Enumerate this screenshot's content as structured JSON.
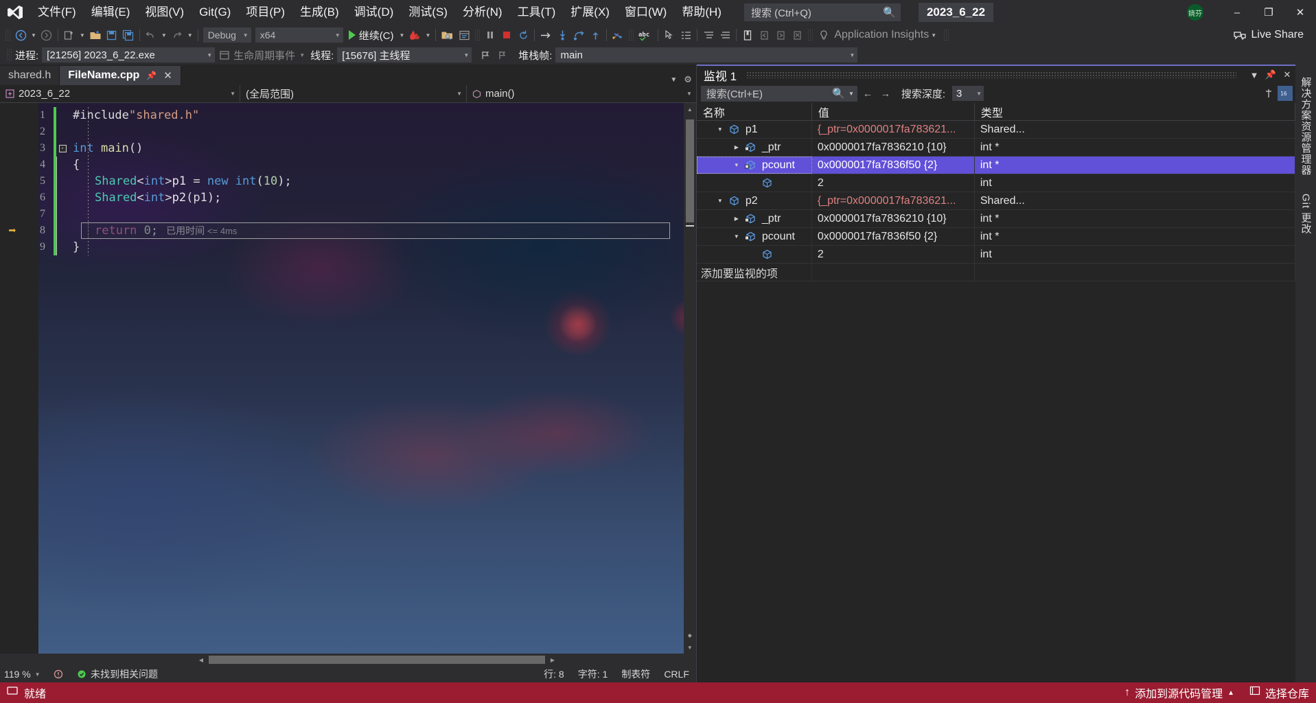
{
  "titlebar": {
    "logo_icon": "visual-studio-logo-icon",
    "menus": [
      {
        "label": "文件(F)"
      },
      {
        "label": "编辑(E)"
      },
      {
        "label": "视图(V)"
      },
      {
        "label": "Git(G)"
      },
      {
        "label": "项目(P)"
      },
      {
        "label": "生成(B)"
      },
      {
        "label": "调试(D)"
      },
      {
        "label": "测试(S)"
      },
      {
        "label": "分析(N)"
      },
      {
        "label": "工具(T)"
      },
      {
        "label": "扩展(X)"
      },
      {
        "label": "窗口(W)"
      },
      {
        "label": "帮助(H)"
      }
    ],
    "quick_search_placeholder": "搜索 (Ctrl+Q)",
    "search_icon": "magnifier-icon",
    "solution_name": "2023_6_22",
    "account_initials": "娆芬",
    "minimize_icon": "minimize-icon",
    "restore_icon": "restore-icon",
    "close_icon": "close-icon"
  },
  "toolbar": {
    "nav_back_icon": "navigate-back-icon",
    "nav_forward_icon": "navigate-forward-icon",
    "new_project_icon": "new-project-icon",
    "open_file_icon": "open-file-icon",
    "save_icon": "save-icon",
    "save_all_icon": "save-all-icon",
    "undo_icon": "undo-icon",
    "redo_icon": "redo-icon",
    "config": "Debug",
    "platform": "x64",
    "continue_label": "继续(C)",
    "continue_icon": "play-icon",
    "hot_reload_icon": "hot-reload-icon",
    "attach_icon": "attach-to-process-icon",
    "live_visual_tree_icon": "live-visual-tree-icon",
    "break_all_icon": "pause-icon",
    "stop_icon": "stop-debugging-icon",
    "restart_icon": "restart-icon",
    "show_next_icon": "show-next-statement-icon",
    "step_into_icon": "step-into-icon",
    "step_over_icon": "step-over-icon",
    "step_out_icon": "step-out-icon",
    "thread_icon": "threads-icon",
    "spell_icon": "spell-check-icon",
    "pointer_icon": "select-element-icon",
    "indent_icon": "indent-icon",
    "comment_icon": "comment-icon",
    "uncomment_icon": "uncomment-icon",
    "bookmark_icon": "bookmark-icon",
    "prev_bookmark_icon": "previous-bookmark-icon",
    "next_bookmark_icon": "next-bookmark-icon",
    "clear_bookmark_icon": "clear-bookmarks-icon",
    "insights_icon": "lightbulb-icon",
    "app_insights": "Application Insights",
    "live_share": "Live Share",
    "live_share_icon": "live-share-icon"
  },
  "debugbar": {
    "process_label": "进程:",
    "process_value": "[21256] 2023_6_22.exe",
    "lifecycle_label": "生命周期事件",
    "lifecycle_icon": "lifecycle-events-icon",
    "thread_label": "线程:",
    "thread_value": "[15676] 主线程",
    "flag_icon": "thread-flag-icon",
    "stackframe_label": "堆栈帧:",
    "stackframe_value": "main"
  },
  "editor": {
    "tabs": [
      {
        "label": "shared.h",
        "active": false
      },
      {
        "label": "FileName.cpp",
        "active": true
      }
    ],
    "tab_pin_icon": "pin-icon",
    "tab_close_icon": "close-icon",
    "nav": {
      "project": "2023_6_22",
      "project_icon": "cpp-project-icon",
      "scope": "(全局范围)",
      "member": "main()",
      "member_icon": "method-icon"
    },
    "lines": [
      {
        "n": "1",
        "tokens": [
          {
            "t": "#include",
            "c": "pp"
          },
          {
            "t": "\"shared.h\"",
            "c": "str"
          }
        ]
      },
      {
        "n": "2",
        "tokens": []
      },
      {
        "n": "3",
        "fold": "-",
        "tokens": [
          {
            "t": "int ",
            "c": "kw"
          },
          {
            "t": "main",
            "c": "fn"
          },
          {
            "t": "()",
            "c": "punc"
          }
        ]
      },
      {
        "n": "4",
        "tokens": [
          {
            "t": "{",
            "c": "punc"
          }
        ]
      },
      {
        "n": "5",
        "indent": 1,
        "tokens": [
          {
            "t": "Shared",
            "c": "type"
          },
          {
            "t": "<",
            "c": "punc"
          },
          {
            "t": "int",
            "c": "kw"
          },
          {
            "t": ">",
            "c": "punc"
          },
          {
            "t": "p1 ",
            "c": "ident"
          },
          {
            "t": "= ",
            "c": "punc"
          },
          {
            "t": "new ",
            "c": "kw"
          },
          {
            "t": "int",
            "c": "kw"
          },
          {
            "t": "(",
            "c": "punc"
          },
          {
            "t": "10",
            "c": "num"
          },
          {
            "t": ");",
            "c": "punc"
          }
        ]
      },
      {
        "n": "6",
        "indent": 1,
        "tokens": [
          {
            "t": "Shared",
            "c": "type"
          },
          {
            "t": "<",
            "c": "punc"
          },
          {
            "t": "int",
            "c": "kw"
          },
          {
            "t": ">",
            "c": "punc"
          },
          {
            "t": "p2",
            "c": "ident"
          },
          {
            "t": "(p1);",
            "c": "punc"
          }
        ]
      },
      {
        "n": "7",
        "indent": 1,
        "tokens": []
      },
      {
        "n": "8",
        "indent": 1,
        "current": true,
        "tokens": [
          {
            "t": "return ",
            "c": "kw2"
          },
          {
            "t": "0",
            "c": "num"
          },
          {
            "t": ";",
            "c": "punc"
          }
        ]
      },
      {
        "n": "9",
        "tokens": [
          {
            "t": "}",
            "c": "punc"
          }
        ]
      }
    ],
    "elapsed_label": "已用时间",
    "elapsed_value": "<= 4ms",
    "exec_arrow_icon": "current-statement-arrow-icon",
    "status": {
      "zoom": "119 %",
      "error_nav_icon": "error-navigation-icon",
      "issues_icon": "check-circle-icon",
      "issues": "未找到相关问题",
      "line_label": "行: 8",
      "char_label": "字符: 1",
      "tabs_label": "制表符",
      "eol_label": "CRLF"
    }
  },
  "watch": {
    "title": "监视 1",
    "float_icon": "window-dropdown-icon",
    "pin_icon": "pin-icon",
    "close_icon": "close-icon",
    "search_placeholder": "搜索(Ctrl+E)",
    "search_icon": "magnifier-icon",
    "search_dropdown_icon": "chevron-down-icon",
    "prev_icon": "arrow-left-icon",
    "next_icon": "arrow-right-icon",
    "depth_label": "搜索深度:",
    "depth_value": "3",
    "pin_col_icon": "pin-column-icon",
    "hex_icon": "hexadecimal-display-icon",
    "columns": [
      "名称",
      "值",
      "类型"
    ],
    "rows": [
      {
        "indent": 1,
        "expander": "expanded",
        "icon": "variable-icon",
        "name": "p1",
        "value": "{_ptr=0x0000017fa783621...",
        "value_style": "struct",
        "type": "Shared...",
        "selected": false
      },
      {
        "indent": 2,
        "expander": "collapsed",
        "icon": "private-field-icon",
        "name": "_ptr",
        "value": "0x0000017fa7836210 {10}",
        "value_style": "plain",
        "type": "int *",
        "selected": false
      },
      {
        "indent": 2,
        "expander": "expanded",
        "icon": "private-field-icon",
        "name": "pcount",
        "value": "0x0000017fa7836f50 {2}",
        "value_style": "plain",
        "type": "int *",
        "selected": true
      },
      {
        "indent": 3,
        "expander": "none",
        "icon": "variable-icon",
        "name": "",
        "value": "2",
        "value_style": "plain",
        "type": "int",
        "selected": false
      },
      {
        "indent": 1,
        "expander": "expanded",
        "icon": "variable-icon",
        "name": "p2",
        "value": "{_ptr=0x0000017fa783621...",
        "value_style": "struct",
        "type": "Shared...",
        "selected": false
      },
      {
        "indent": 2,
        "expander": "collapsed",
        "icon": "private-field-icon",
        "name": "_ptr",
        "value": "0x0000017fa7836210 {10}",
        "value_style": "plain",
        "type": "int *",
        "selected": false
      },
      {
        "indent": 2,
        "expander": "expanded",
        "icon": "private-field-icon",
        "name": "pcount",
        "value": "0x0000017fa7836f50 {2}",
        "value_style": "plain",
        "type": "int *",
        "selected": false
      },
      {
        "indent": 3,
        "expander": "none",
        "icon": "variable-icon",
        "name": "",
        "value": "2",
        "value_style": "plain",
        "type": "int",
        "selected": false
      }
    ],
    "add_item_placeholder": "添加要监视的项"
  },
  "rightdock": {
    "items": [
      {
        "label": "解决方案资源管理器"
      },
      {
        "label": "Git 更改"
      }
    ]
  },
  "statusbar": {
    "ready_icon": "ready-icon",
    "ready": "就绪",
    "source_control": "添加到源代码管理",
    "source_control_icon": "source-control-icon",
    "source_control_caret": "chevron-up-icon",
    "repo": "选择仓库",
    "repo_icon": "repository-icon",
    "bg_color": "#9b1c31"
  }
}
